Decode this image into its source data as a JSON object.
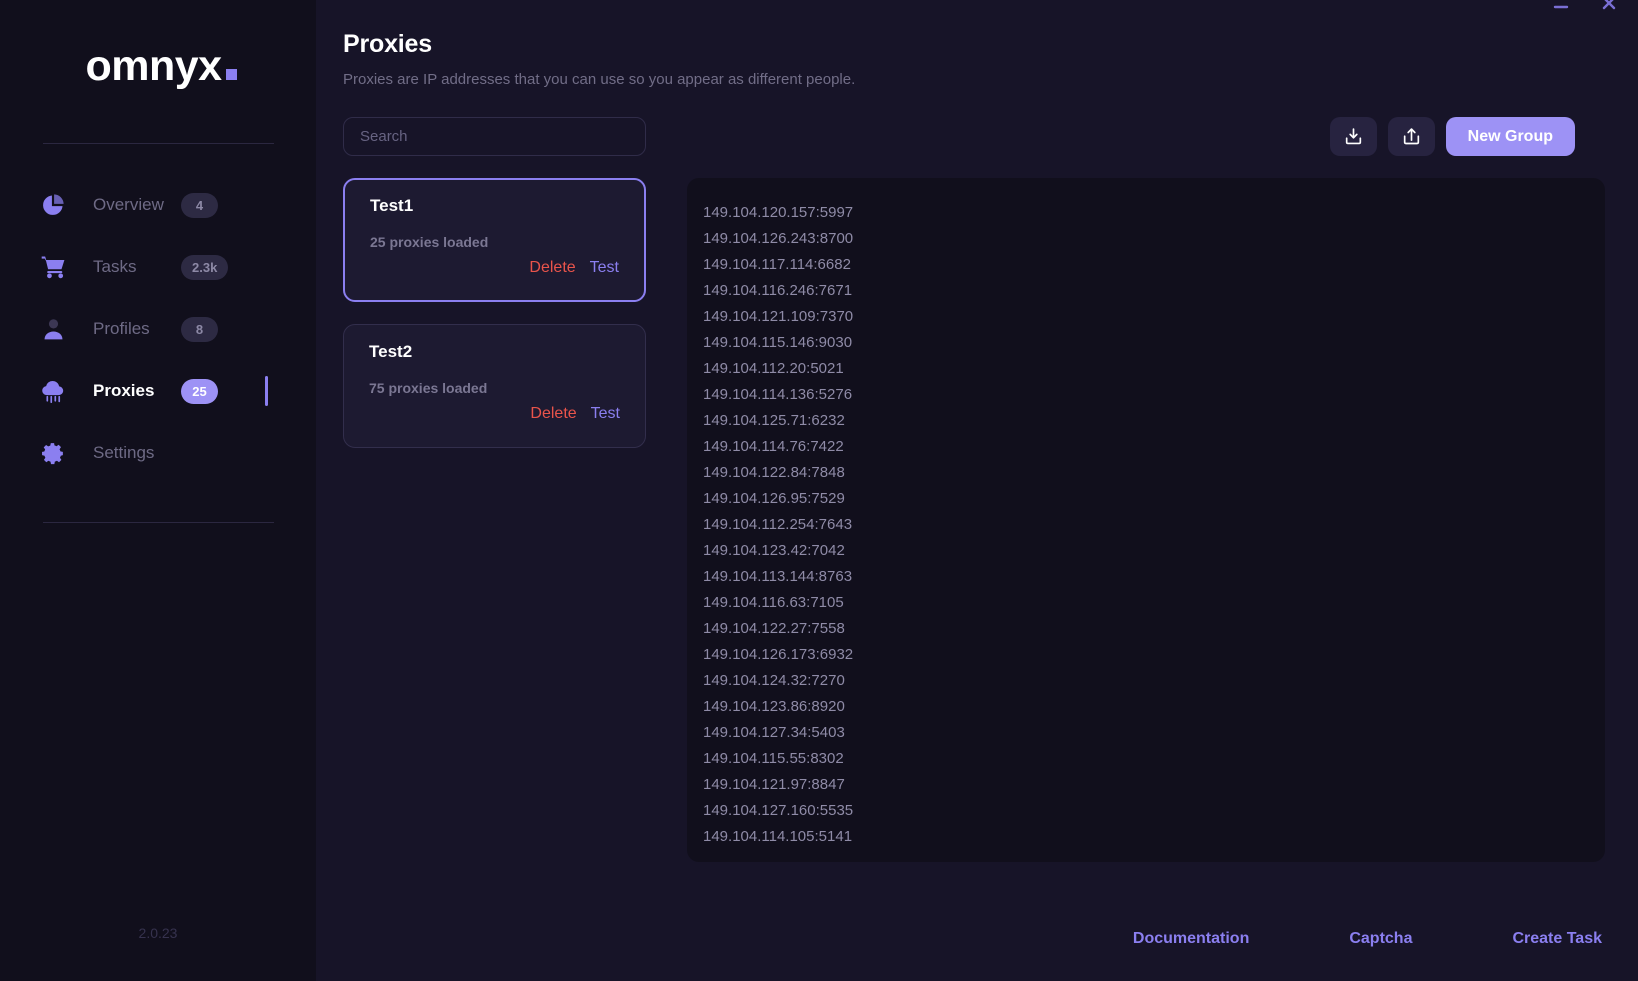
{
  "window": {
    "controls": [
      {
        "name": "minimize",
        "icon": "minimize-icon"
      },
      {
        "name": "close",
        "icon": "close-icon"
      }
    ]
  },
  "sidebar": {
    "logo": {
      "text": "omnyx",
      "dot": "",
      "accent": "#8b7ff0"
    },
    "items": [
      {
        "label": "Overview",
        "badge": "4",
        "icon": "pie-chart-icon",
        "active": false
      },
      {
        "label": "Tasks",
        "badge": "2.3k",
        "icon": "cart-icon",
        "active": false
      },
      {
        "label": "Profiles",
        "badge": "8",
        "icon": "user-icon",
        "active": false
      },
      {
        "label": "Proxies",
        "badge": "25",
        "icon": "cloud-rain-icon",
        "active": true
      },
      {
        "label": "Settings",
        "badge": "",
        "icon": "gear-icon",
        "active": false
      }
    ],
    "version": "2.0.23"
  },
  "header": {
    "title": "Proxies",
    "subtitle": "Proxies are IP addresses that you can use so you appear as different people."
  },
  "toolbar": {
    "search_value": "",
    "search_placeholder": "Search",
    "import_icon": "download-icon",
    "export_icon": "share-upload-icon",
    "new_group_label": "New Group"
  },
  "groups": [
    {
      "name": "Test1",
      "count_label": "25 proxies loaded",
      "delete_label": "Delete",
      "test_label": "Test",
      "selected": true
    },
    {
      "name": "Test2",
      "count_label": "75 proxies loaded",
      "delete_label": "Delete",
      "test_label": "Test",
      "selected": false
    }
  ],
  "proxies": [
    "149.104.120.157:5997",
    "149.104.126.243:8700",
    "149.104.117.114:6682",
    "149.104.116.246:7671",
    "149.104.121.109:7370",
    "149.104.115.146:9030",
    "149.104.112.20:5021",
    "149.104.114.136:5276",
    "149.104.125.71:6232",
    "149.104.114.76:7422",
    "149.104.122.84:7848",
    "149.104.126.95:7529",
    "149.104.112.254:7643",
    "149.104.123.42:7042",
    "149.104.113.144:8763",
    "149.104.116.63:7105",
    "149.104.122.27:7558",
    "149.104.126.173:6932",
    "149.104.124.32:7270",
    "149.104.123.86:8920",
    "149.104.127.34:5403",
    "149.104.115.55:8302",
    "149.104.121.97:8847",
    "149.104.127.160:5535",
    "149.104.114.105:5141"
  ],
  "footer": {
    "links": [
      {
        "label": "Documentation"
      },
      {
        "label": "Captcha"
      },
      {
        "label": "Create Task"
      }
    ]
  },
  "colors": {
    "accent": "#8b7ff0",
    "accent_light": "#9d92f5",
    "danger": "#e9544b",
    "bg_dark": "#110f1c",
    "bg_main": "#171428",
    "card": "#1d1a31"
  }
}
